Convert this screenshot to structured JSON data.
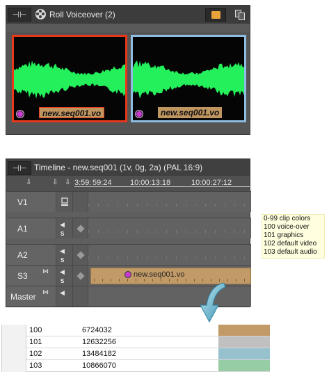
{
  "bin": {
    "pin_glyph": "⊣⊢",
    "title": "Roll  Voiceover (2)",
    "clips": [
      {
        "name": "new.seq001.vo",
        "border_color": "#e8371a",
        "wave_color": "#23f05a"
      },
      {
        "name": "new.seq001.vo",
        "border_color": "#8ebde4",
        "wave_color": "#23f05a"
      }
    ]
  },
  "timeline": {
    "pin_glyph": "⊣⊢",
    "title": "Timeline - new.seq001 (1v, 0g, 2a) (PAL 16:9)",
    "header_arrows": [
      "⇩",
      "⇩",
      "⇩"
    ],
    "timecodes": [
      "3:59:",
      "59:24",
      "10:00:13:18",
      "10:00:27:12"
    ],
    "tracks": [
      {
        "label": "V1",
        "kind": "video"
      },
      {
        "label": "A1",
        "kind": "audio",
        "solo": "S"
      },
      {
        "label": "A2",
        "kind": "audio",
        "solo": "S"
      },
      {
        "label": "S3",
        "kind": "audio",
        "solo": "S",
        "clip": "new.seq001.vo"
      },
      {
        "label": "Master",
        "kind": "master"
      }
    ]
  },
  "legend": [
    "0-99 clip colors",
    "100 voice-over",
    "101 graphics",
    "102 default video",
    "103 default audio"
  ],
  "table": [
    {
      "id": "100",
      "value": "6724032",
      "color": "#c29a67"
    },
    {
      "id": "101",
      "value": "12632256",
      "color": "#c0c0c0"
    },
    {
      "id": "102",
      "value": "13484182",
      "color": "#96c1cd"
    },
    {
      "id": "103",
      "value": "10866070",
      "color": "#96cda5"
    }
  ]
}
